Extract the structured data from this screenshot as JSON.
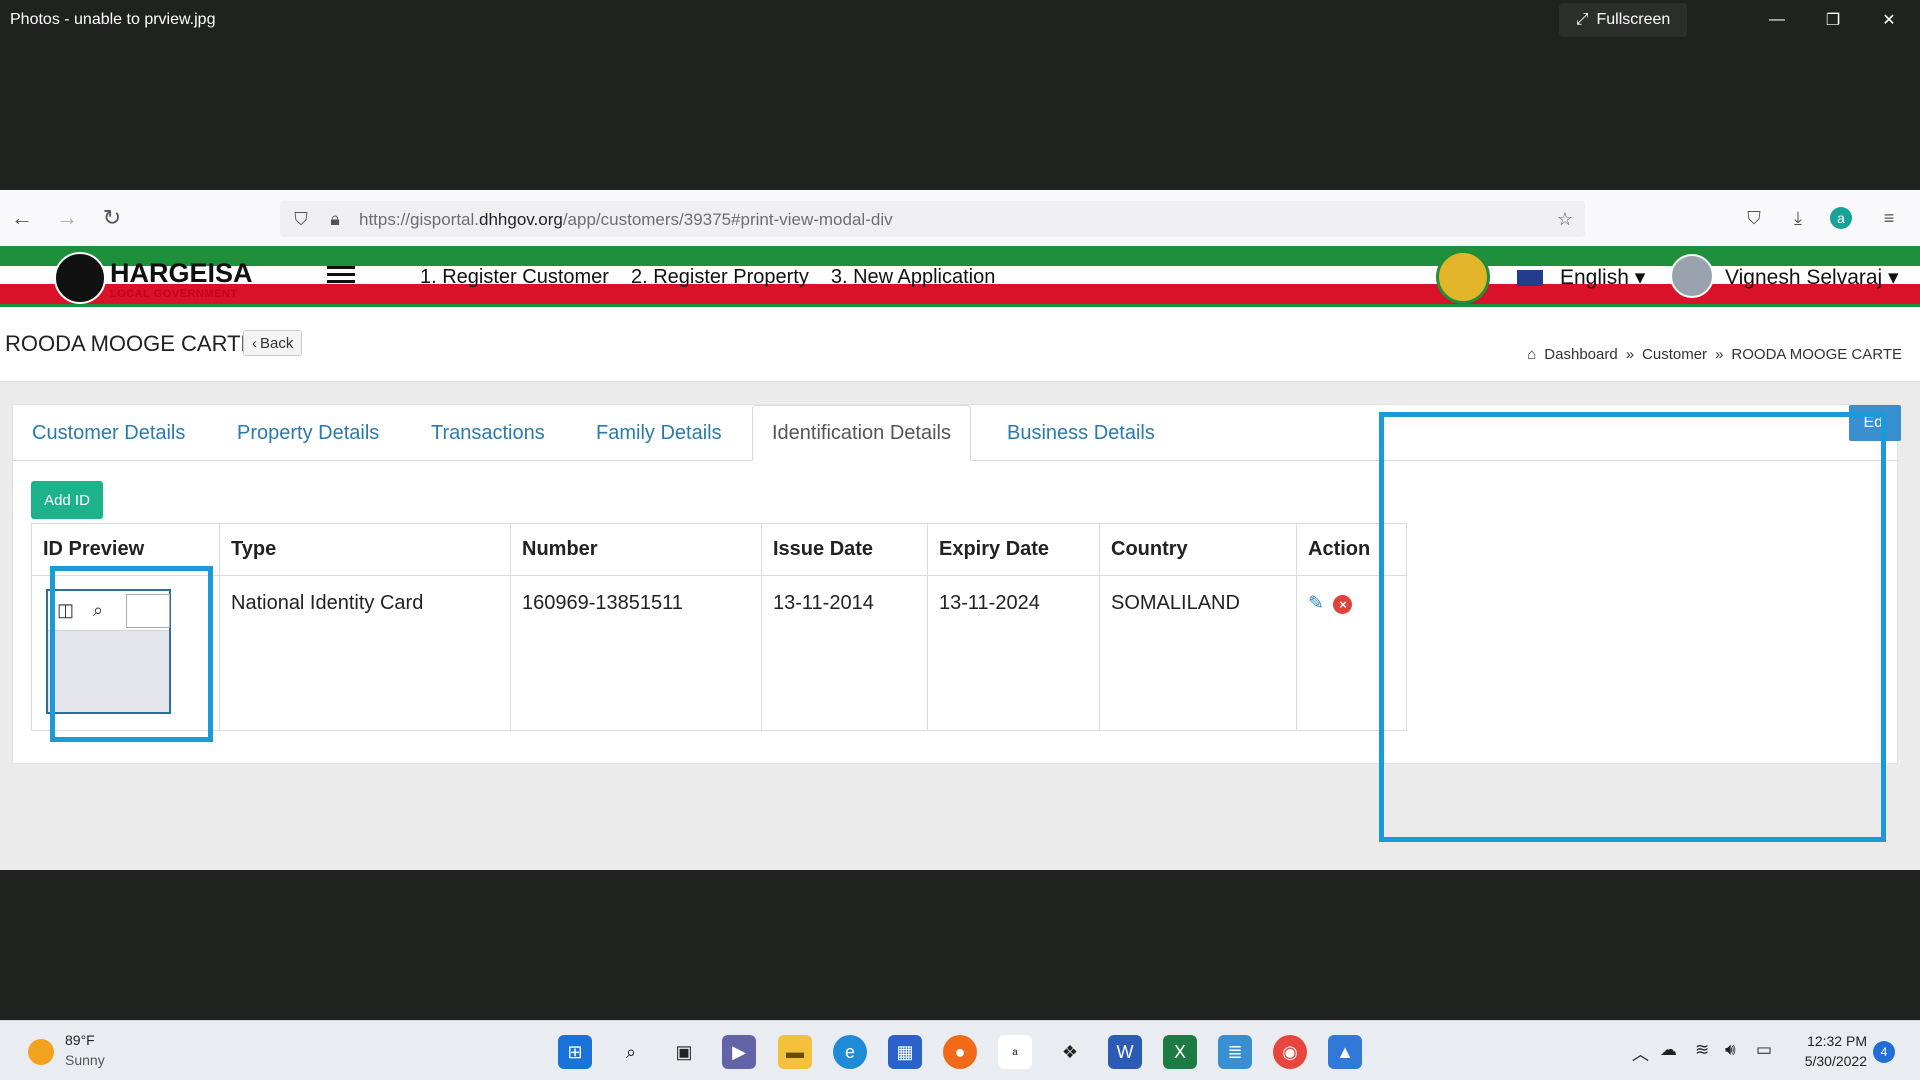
{
  "viewer": {
    "title": "Photos - unable to prview.jpg",
    "fullscreen_label": "Fullscreen",
    "fullscreen_icon": "expand-icon",
    "window_controls": [
      "minimize-icon",
      "restore-icon",
      "close-icon"
    ]
  },
  "browser": {
    "url_prefix": "https://gisportal.",
    "url_domain": "dhhgov.org",
    "url_path": "/app/customers/39375#print-view-modal-div"
  },
  "header": {
    "logo_text": "HARGEISA",
    "logo_subtext": "LOCAL GOVERNMENT",
    "nav": [
      "1. Register Customer",
      "2. Register Property",
      "3. New Application"
    ],
    "language": "English",
    "user": "Vignesh Selvaraj",
    "colors": {
      "green": "#1e8f3a",
      "red": "#d9122a"
    }
  },
  "page": {
    "title": "ROODA MOOGE CARTE",
    "back_label": "Back",
    "breadcrumb": [
      "Dashboard",
      "Customer",
      "ROODA MOOGE CARTE"
    ]
  },
  "tabs": [
    "Customer Details",
    "Property Details",
    "Transactions",
    "Family Details",
    "Identification Details",
    "Business Details"
  ],
  "active_tab": "Identification Details",
  "edit_label": "Edi",
  "add_id_label": "Add ID",
  "table": {
    "headers": [
      "ID Preview",
      "Type",
      "Number",
      "Issue Date",
      "Expiry Date",
      "Country",
      "Action"
    ],
    "rows": [
      {
        "type": "National Identity Card",
        "number": "160969-13851511",
        "issue_date": "13-11-2014",
        "expiry_date": "13-11-2024",
        "country": "SOMALILAND"
      }
    ]
  },
  "taskbar": {
    "weather_temp": "89°F",
    "weather_desc": "Sunny",
    "time": "12:32 PM",
    "date": "5/30/2022",
    "notifications": "4"
  },
  "accent_color": "#1a9ad6"
}
